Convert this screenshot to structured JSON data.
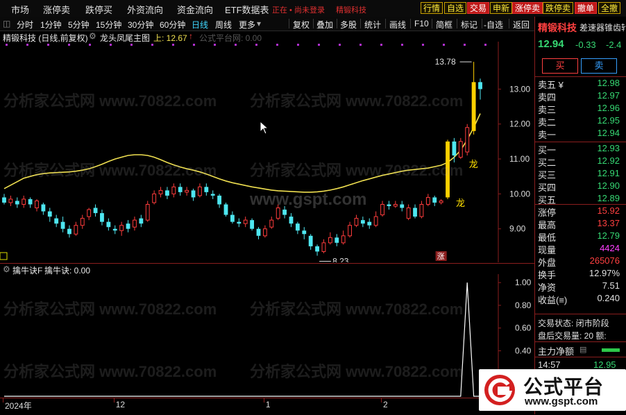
{
  "menu": {
    "items": [
      "市场",
      "涨停卖",
      "跌停买",
      "外资流向",
      "资金流向",
      "ETF数据表"
    ],
    "status_text": "正在 • 尚未登录",
    "stock_tag": "精锻科技",
    "quick_buttons": [
      "行情",
      "自选",
      "交易",
      "申新",
      "涨停卖",
      "跌停卖",
      "撤单",
      "全撤"
    ]
  },
  "toolbar": {
    "left": [
      "分时",
      "1分钟",
      "5分钟",
      "15分钟",
      "30分钟",
      "60分钟",
      "日线",
      "周线",
      "更多"
    ],
    "active": "日线",
    "right": [
      "复权",
      "叠加",
      "多股",
      "统计",
      "画线",
      "F10",
      "简框",
      "标记",
      "-自选",
      "返回"
    ]
  },
  "chart_header": {
    "stock": "精锻科技 (日线,前复权)",
    "indicator": "龙头凤尾主图",
    "up_label": "上: 12.67",
    "platform": "公式平台网: 0.00"
  },
  "sub_header": {
    "name": "擒牛诀F",
    "value_label": "擒牛诀: 0.00"
  },
  "watermarks": [
    "分析家公式网 www.70822.com",
    "www.gspt.com"
  ],
  "chart_data": [
    {
      "type": "candlestick",
      "title": "龙头凤尾主图",
      "ylim": [
        8.2,
        14.2
      ],
      "y_ticks": [
        9.0,
        10.0,
        11.0,
        12.0,
        13.0
      ],
      "annotations": [
        {
          "text": "13.78",
          "at": "high"
        },
        {
          "text": "8.23",
          "at": "low"
        },
        {
          "text": "龙",
          "note": "signal"
        },
        {
          "text": "龙",
          "note": "signal"
        },
        {
          "text": "涨",
          "note": "badge"
        }
      ],
      "candles": [
        [
          9.9,
          9.75,
          10.0,
          9.7
        ],
        [
          9.75,
          9.85,
          9.95,
          9.65
        ],
        [
          9.8,
          9.7,
          9.9,
          9.6
        ],
        [
          9.7,
          9.85,
          9.95,
          9.6
        ],
        [
          9.85,
          9.7,
          9.9,
          9.6
        ],
        [
          9.6,
          9.8,
          9.85,
          9.5
        ],
        [
          9.7,
          9.5,
          9.75,
          9.4
        ],
        [
          9.5,
          9.35,
          9.6,
          9.2
        ],
        [
          9.3,
          9.15,
          9.4,
          9.05
        ],
        [
          9.2,
          9.0,
          9.35,
          8.9
        ],
        [
          9.0,
          8.85,
          9.1,
          8.75
        ],
        [
          8.85,
          9.1,
          9.2,
          8.8
        ],
        [
          9.1,
          9.3,
          9.4,
          9.0
        ],
        [
          9.35,
          9.55,
          9.6,
          9.25
        ],
        [
          9.6,
          9.45,
          9.7,
          9.35
        ],
        [
          9.45,
          9.2,
          9.55,
          9.1
        ],
        [
          9.2,
          9.05,
          9.3,
          8.95
        ],
        [
          9.0,
          8.95,
          9.1,
          8.85
        ],
        [
          8.95,
          9.1,
          9.2,
          8.8
        ],
        [
          9.15,
          9.0,
          9.25,
          8.9
        ],
        [
          9.05,
          9.25,
          9.35,
          8.95
        ],
        [
          9.3,
          9.15,
          9.4,
          9.05
        ],
        [
          9.25,
          9.7,
          9.8,
          9.2
        ],
        [
          9.75,
          10.0,
          10.1,
          9.7
        ],
        [
          10.0,
          10.1,
          10.2,
          9.9
        ],
        [
          10.1,
          9.95,
          10.2,
          9.85
        ],
        [
          10.0,
          10.2,
          10.3,
          9.9
        ],
        [
          10.2,
          10.05,
          10.3,
          9.95
        ],
        [
          10.05,
          10.1,
          10.2,
          9.95
        ],
        [
          10.1,
          9.9,
          10.15,
          9.8
        ],
        [
          9.95,
          10.2,
          10.3,
          9.9
        ],
        [
          10.2,
          10.05,
          10.3,
          9.95
        ],
        [
          10.0,
          9.95,
          10.1,
          9.85
        ],
        [
          9.95,
          9.7,
          10.0,
          9.6
        ],
        [
          9.7,
          9.4,
          9.75,
          9.35
        ],
        [
          9.4,
          9.2,
          9.5,
          9.15
        ],
        [
          9.2,
          9.15,
          9.3,
          9.05
        ],
        [
          9.15,
          9.25,
          9.35,
          9.05
        ],
        [
          9.25,
          9.0,
          9.3,
          8.95
        ],
        [
          9.0,
          8.8,
          9.05,
          8.7
        ],
        [
          8.8,
          9.0,
          9.1,
          8.75
        ],
        [
          9.05,
          9.25,
          9.35,
          9.0
        ],
        [
          9.3,
          9.6,
          9.7,
          9.25
        ],
        [
          9.55,
          9.4,
          9.65,
          9.3
        ],
        [
          9.35,
          9.15,
          9.45,
          9.05
        ],
        [
          9.15,
          8.95,
          9.2,
          8.85
        ],
        [
          8.95,
          8.85,
          9.05,
          8.7
        ],
        [
          8.8,
          8.5,
          8.85,
          8.4
        ],
        [
          8.5,
          8.35,
          8.55,
          8.23
        ],
        [
          8.35,
          8.6,
          8.7,
          8.3
        ],
        [
          8.6,
          8.75,
          8.9,
          8.55
        ],
        [
          8.75,
          8.6,
          8.85,
          8.5
        ],
        [
          8.6,
          8.8,
          8.95,
          8.55
        ],
        [
          8.8,
          9.1,
          9.2,
          8.75
        ],
        [
          9.1,
          9.3,
          9.4,
          9.05
        ],
        [
          9.25,
          9.15,
          9.35,
          9.05
        ],
        [
          9.2,
          9.1,
          9.3,
          9.0
        ],
        [
          9.1,
          9.35,
          9.5,
          9.05
        ],
        [
          9.4,
          9.7,
          9.8,
          9.35
        ],
        [
          9.7,
          9.65,
          9.8,
          9.55
        ],
        [
          9.65,
          9.7,
          9.8,
          9.6
        ],
        [
          9.7,
          9.6,
          9.8,
          9.5
        ],
        [
          9.3,
          9.6,
          9.7,
          9.25
        ],
        [
          9.6,
          9.35,
          9.7,
          9.3
        ],
        [
          9.35,
          9.7,
          9.8,
          9.3
        ],
        [
          9.7,
          9.9,
          10.0,
          9.65
        ],
        [
          9.9,
          9.75,
          9.95,
          9.65
        ],
        [
          9.75,
          9.8,
          9.85,
          9.7
        ],
        [
          9.9,
          11.5,
          11.55,
          9.85
        ],
        [
          11.5,
          11.1,
          11.6,
          10.9
        ],
        [
          11.05,
          11.5,
          11.6,
          11.0
        ],
        [
          11.2,
          11.9,
          12.0,
          11.1
        ],
        [
          11.8,
          13.2,
          13.78,
          11.7
        ],
        [
          13.2,
          13.0,
          13.3,
          12.7
        ]
      ],
      "series": [
        {
          "name": "上",
          "color": "#f0e050",
          "values": [
            10.15,
            10.25,
            10.35,
            10.45,
            10.5,
            10.55,
            10.58,
            10.6,
            10.61,
            10.62,
            10.63,
            10.65,
            10.68,
            10.72,
            10.78,
            10.85,
            10.93,
            11.0,
            11.05,
            11.1,
            11.12,
            11.12,
            11.1,
            11.05,
            10.98,
            10.9,
            10.83,
            10.77,
            10.72,
            10.68,
            10.63,
            10.57,
            10.5,
            10.43,
            10.37,
            10.32,
            10.28,
            10.24,
            10.2,
            10.17,
            10.14,
            10.11,
            10.09,
            10.08,
            10.07,
            10.06,
            10.05,
            10.05,
            10.06,
            10.08,
            10.11,
            10.15,
            10.2,
            10.26,
            10.32,
            10.38,
            10.43,
            10.48,
            10.53,
            10.57,
            10.61,
            10.65,
            10.68,
            10.7,
            10.72,
            10.74,
            10.78,
            10.82,
            10.9,
            11.05,
            11.25,
            11.55,
            11.9,
            12.3
          ]
        }
      ]
    },
    {
      "type": "line",
      "title": "擒牛诀F",
      "ylim": [
        0,
        1.05
      ],
      "y_ticks": [
        0.4,
        0.6,
        0.8,
        1.0
      ],
      "series": [
        {
          "name": "擒牛诀",
          "color": "#ffffff",
          "values": [
            0,
            0,
            0,
            0,
            0,
            0,
            0,
            0,
            0,
            0,
            0,
            0,
            0,
            0,
            0,
            0,
            0,
            0,
            0,
            0,
            0,
            0,
            0,
            0,
            0,
            0,
            0,
            0,
            0,
            0,
            0,
            0,
            0,
            0,
            0,
            0,
            0,
            0,
            0,
            0,
            0,
            0,
            0,
            0,
            0,
            0,
            0,
            0,
            0,
            0,
            0,
            0,
            0,
            0,
            0,
            0,
            0,
            0,
            0,
            0,
            0,
            0,
            0,
            0,
            0,
            0,
            0,
            0,
            0,
            0,
            0,
            1,
            0,
            0
          ]
        }
      ]
    }
  ],
  "x_axis_labels": [
    {
      "text": "2024年",
      "index": 0
    },
    {
      "text": "12",
      "index": 17
    },
    {
      "text": "1",
      "index": 40
    },
    {
      "text": "2",
      "index": 58
    }
  ],
  "quote": {
    "name": "精锻科技",
    "subtitle": "差速器锥齿轮",
    "price": "12.94",
    "change": "-0.33",
    "pct": "-2.4",
    "buy_label": "买",
    "sell_label": "卖",
    "asks": [
      {
        "label": "卖五 ¥",
        "price": "12.98"
      },
      {
        "label": "卖四",
        "price": "12.97"
      },
      {
        "label": "卖三",
        "price": "12.96"
      },
      {
        "label": "卖二",
        "price": "12.95"
      },
      {
        "label": "卖一",
        "price": "12.94"
      }
    ],
    "bids": [
      {
        "label": "买一",
        "price": "12.93"
      },
      {
        "label": "买二",
        "price": "12.92"
      },
      {
        "label": "买三",
        "price": "12.91"
      },
      {
        "label": "买四",
        "price": "12.90"
      },
      {
        "label": "买五",
        "price": "12.89"
      }
    ],
    "stats": [
      {
        "label": "涨停",
        "value": "15.92",
        "color": "r"
      },
      {
        "label": "最高",
        "value": "13.37",
        "color": "r"
      },
      {
        "label": "最低",
        "value": "12.79",
        "color": "g"
      },
      {
        "label": "现量",
        "value": "4424",
        "color": "m"
      },
      {
        "label": "外盘",
        "value": "265076",
        "color": "r"
      },
      {
        "label": "换手",
        "value": "12.97%",
        "color": "w"
      },
      {
        "label": "净资",
        "value": "7.51",
        "color": "w"
      },
      {
        "label": "收益(≡)",
        "value": "0.240",
        "color": "w"
      }
    ],
    "trade_status": "交易状态: 闭市阶段",
    "after_hours": "盘后交易量: 20  额:",
    "main_flow": "主力净额",
    "tick_time": "14:57",
    "tick_price": "12.95"
  },
  "logo": {
    "brand": "公式平台",
    "url": "www.gspt.com"
  }
}
